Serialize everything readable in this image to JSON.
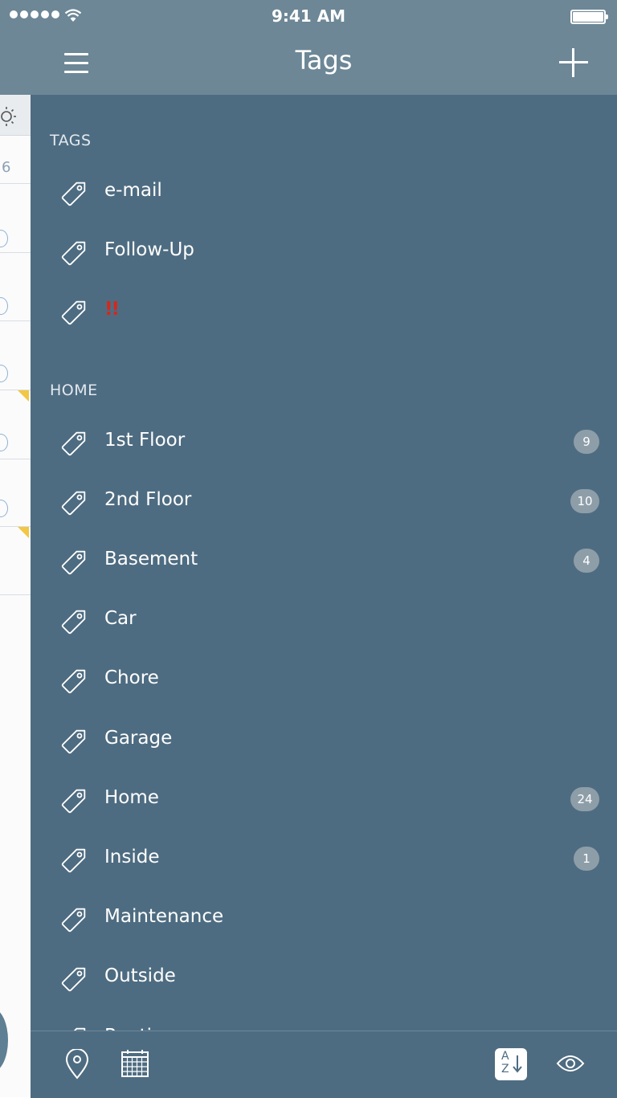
{
  "status_bar": {
    "time": "9:41 AM"
  },
  "background_list": {
    "visible_number": "6"
  },
  "header": {
    "title": "Tags"
  },
  "sections": [
    {
      "title": "TAGS",
      "items": [
        {
          "label": "e-mail",
          "count": ""
        },
        {
          "label": "Follow-Up",
          "count": ""
        },
        {
          "label": "!!",
          "count": "",
          "alert": true
        }
      ]
    },
    {
      "title": "HOME",
      "items": [
        {
          "label": "1st Floor",
          "count": "9"
        },
        {
          "label": "2nd Floor",
          "count": "10"
        },
        {
          "label": "Basement",
          "count": "4"
        },
        {
          "label": "Car",
          "count": ""
        },
        {
          "label": "Chore",
          "count": ""
        },
        {
          "label": "Garage",
          "count": ""
        },
        {
          "label": "Home",
          "count": "24"
        },
        {
          "label": "Inside",
          "count": "1"
        },
        {
          "label": "Maintenance",
          "count": ""
        },
        {
          "label": "Outside",
          "count": ""
        },
        {
          "label": "Routine",
          "count": ""
        }
      ]
    }
  ],
  "sort_button": {
    "top": "A",
    "bottom": "Z"
  },
  "colors": {
    "panel_bg": "#4e6c81",
    "nav_bg": "#6d8796",
    "badge_bg": "#8e9ea9",
    "alert": "#d8261c",
    "accent_yellow": "#f2c744"
  },
  "icons": {
    "menu": "hamburger-icon",
    "add": "plus-icon",
    "tag": "tag-icon",
    "location": "location-pin-icon",
    "calendar": "calendar-icon",
    "sort": "sort-az-icon",
    "visibility": "eye-icon"
  }
}
